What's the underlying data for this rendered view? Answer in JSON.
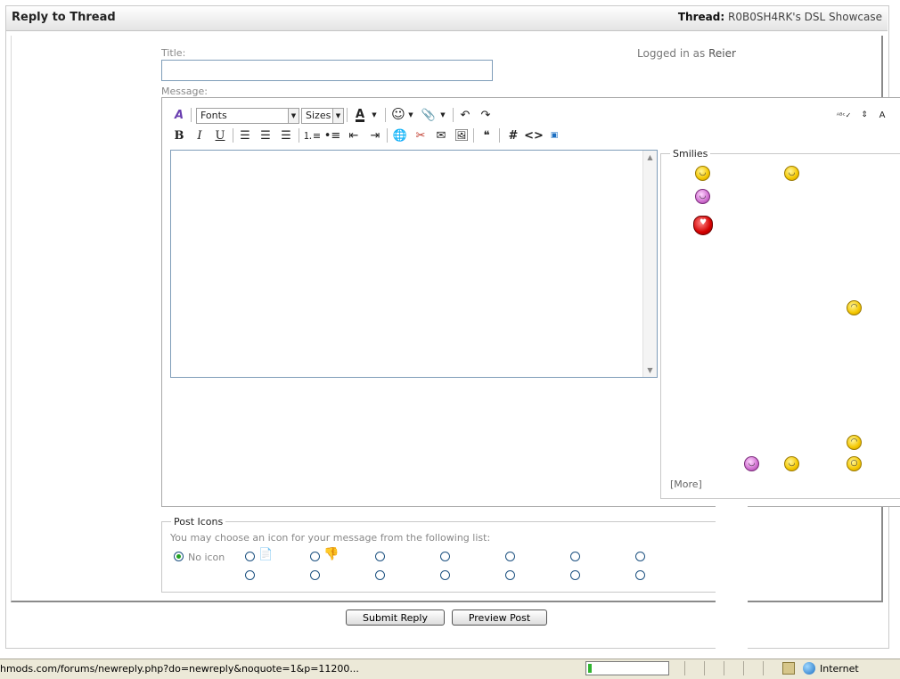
{
  "header": {
    "title": "Reply to Thread",
    "thread_label": "Thread:",
    "thread_name": "R0B0SH4RK's DSL Showcase"
  },
  "form": {
    "title_label": "Title:",
    "title_value": "",
    "logged_in_prefix": "Logged in as",
    "username": "Reier",
    "message_label": "Message:"
  },
  "toolbar": {
    "font_select": "Fonts",
    "size_select": "Sizes"
  },
  "smilies": {
    "legend": "Smilies",
    "more_label": "[More]"
  },
  "post_icons": {
    "legend": "Post Icons",
    "description": "You may choose an icon for your message from the following list:",
    "no_icon_label": "No icon"
  },
  "buttons": {
    "submit": "Submit Reply",
    "preview": "Preview Post"
  },
  "statusbar": {
    "url": "hmods.com/forums/newreply.php?do=newreply&noquote=1&p=11200...",
    "zone": "Internet",
    "progress": 0.05
  },
  "colors": {
    "accent_green": "#21a121",
    "border_blue": "#7f9db9"
  }
}
